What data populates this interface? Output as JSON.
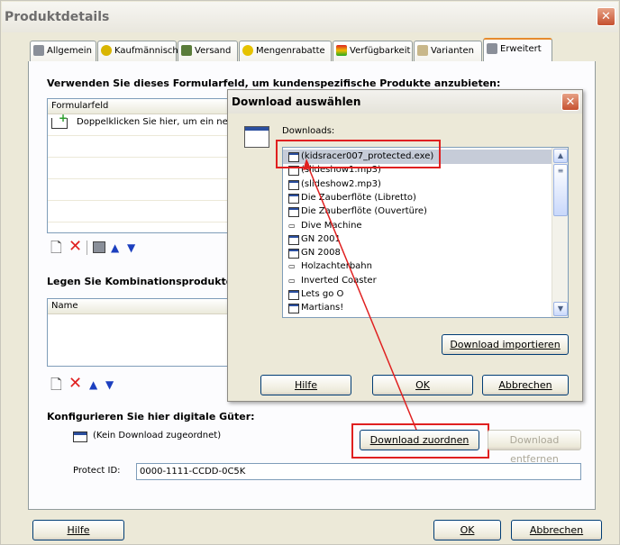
{
  "window": {
    "title": "Produktdetails",
    "close_glyph": "✕"
  },
  "tabs": [
    {
      "label": "Allgemein",
      "icon": "document-properties-icon"
    },
    {
      "label": "Kaufmännisch",
      "icon": "coin-icon"
    },
    {
      "label": "Versand",
      "icon": "truck-icon"
    },
    {
      "label": "Mengenrabatte",
      "icon": "percent-icon"
    },
    {
      "label": "Verfügbarkeit",
      "icon": "traffic-light-icon"
    },
    {
      "label": "Varianten",
      "icon": "shirt-icon"
    },
    {
      "label": "Erweitert",
      "icon": "advanced-icon",
      "active": true
    }
  ],
  "section1": {
    "heading": "Verwenden Sie dieses Formularfeld, um kundenspezifische Produkte anzubieten:",
    "column": "Formularfeld",
    "first_row": "Doppelklicken Sie hier, um ein neues"
  },
  "section2": {
    "heading": "Legen Sie Kombinationsprodukte fest,",
    "column": "Name"
  },
  "section3": {
    "heading": "Konfigurieren Sie hier digitale Güter:",
    "no_download": "(Kein Download zugeordnet)",
    "assign_button": "Download zuordnen",
    "remove_button": "Download entfernen",
    "protect_label": "Protect ID:",
    "protect_value": "0000-1111-CCDD-0C5K"
  },
  "footer": {
    "help": "Hilfe",
    "ok": "OK",
    "cancel": "Abbrechen"
  },
  "dialog": {
    "title": "Download auswählen",
    "downloads_label": "Downloads:",
    "items": [
      {
        "label": "(kidsracer007_protected.exe)",
        "kind": "file",
        "selected": true
      },
      {
        "label": "(slideshow1.mp3)",
        "kind": "file"
      },
      {
        "label": "(slideshow2.mp3)",
        "kind": "file"
      },
      {
        "label": "Die Zauberflöte (Libretto)",
        "kind": "file"
      },
      {
        "label": "Die Zauberflöte (Ouvertüre)",
        "kind": "file"
      },
      {
        "label": "Dive Machine",
        "kind": "video"
      },
      {
        "label": "GN 2001",
        "kind": "file"
      },
      {
        "label": "GN 2008",
        "kind": "file"
      },
      {
        "label": "Holzachterbahn",
        "kind": "video"
      },
      {
        "label": "Inverted Coaster",
        "kind": "video"
      },
      {
        "label": "Lets go O",
        "kind": "file"
      },
      {
        "label": "Martians!",
        "kind": "file"
      }
    ],
    "import_button": "Download importieren",
    "help": "Hilfe",
    "ok": "OK",
    "cancel": "Abbrechen"
  },
  "colors": {
    "annotation_red": "#e02020",
    "selection": "#c6ccd8",
    "accent_tab": "#e68b2c"
  }
}
